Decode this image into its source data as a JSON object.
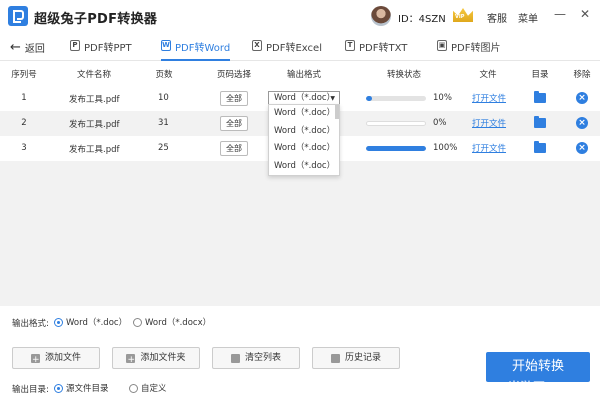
{
  "titlebar": {
    "app_title": "超级兔子PDF转换器",
    "user_id": "ID：4SZN",
    "vip_badge": "VIP",
    "service_label": "客服",
    "menu_label": "菜单",
    "minimize": "—",
    "close": "✕"
  },
  "nav": {
    "back_label": "返回",
    "tabs": [
      {
        "label": "PDF转PPT",
        "icon": "P"
      },
      {
        "label": "PDF转Word",
        "icon": "W"
      },
      {
        "label": "PDF转Excel",
        "icon": "X"
      },
      {
        "label": "PDF转TXT",
        "icon": "T"
      },
      {
        "label": "PDF转图片",
        "icon": "▣"
      }
    ],
    "active_tab": "PDF转Word"
  },
  "table": {
    "headers": [
      "序列号",
      "文件名称",
      "页数",
      "页码选择",
      "输出格式",
      "转换状态",
      "文件",
      "目录",
      "移除"
    ],
    "rows": [
      {
        "index": "1",
        "name": "发布工具.pdf",
        "pages": "10",
        "page_select": "全部",
        "format": "Word（*.doc）",
        "progress": 10,
        "percent": "10%",
        "open": "打开文件"
      },
      {
        "index": "2",
        "name": "发布工具.pdf",
        "pages": "31",
        "page_select": "全部",
        "format": "Word（*.doc）",
        "progress": 0,
        "percent": "0%",
        "open": "打开文件"
      },
      {
        "index": "3",
        "name": "发布工具.pdf",
        "pages": "25",
        "page_select": "全部",
        "format": "Word（*.doc）",
        "progress": 100,
        "percent": "100%",
        "open": "打开文件"
      }
    ],
    "dropdown_options": [
      "Word（*.doc）",
      "Word（*.doc）",
      "Word（*.doc）",
      "Word（*.doc）"
    ],
    "accent_color": "#2f7fe0"
  },
  "bottom": {
    "output_format_label": "输出格式:",
    "format_options": [
      {
        "label": "Word（*.doc）",
        "checked": true
      },
      {
        "label": "Word（*.docx）",
        "checked": false
      }
    ],
    "buttons": {
      "add_file": "添加文件",
      "add_folder": "添加文件夹",
      "clear_list": "清空列表",
      "history": "历史记录",
      "start": "开始转换"
    },
    "output_dir_label": "输出目录:",
    "dir_options": [
      {
        "label": "源文件目录",
        "checked": true
      },
      {
        "label": "自定义",
        "checked": false
      }
    ]
  },
  "watermark": "当游网"
}
